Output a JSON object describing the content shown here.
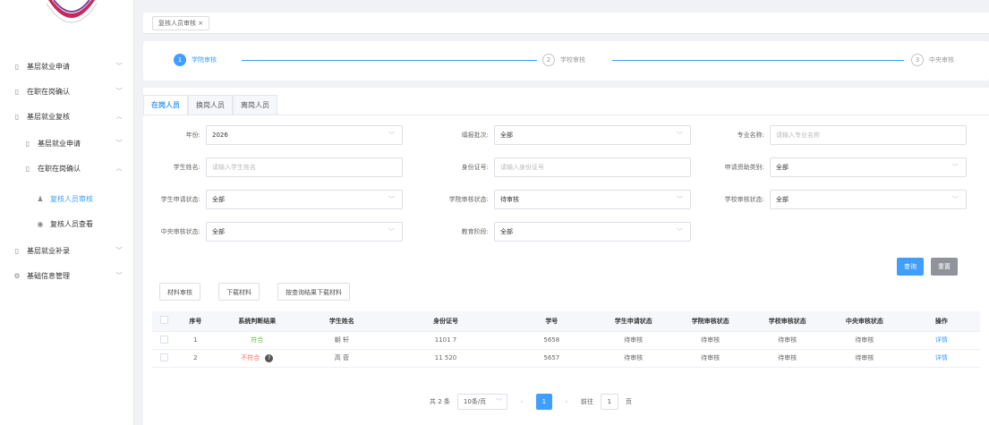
{
  "sidebar": {
    "items": [
      {
        "icon": "doc-icon",
        "label": "基层就业申请",
        "arrow": "﹀",
        "active": false
      },
      {
        "icon": "doc-icon",
        "label": "在职在岗确认",
        "arrow": "﹀",
        "active": false
      },
      {
        "icon": "doc-icon",
        "label": "基层就业复核",
        "arrow": "︿",
        "active": false
      },
      {
        "icon": "doc-icon",
        "label": "基层就业申请",
        "arrow": "﹀",
        "active": false
      },
      {
        "icon": "doc-icon",
        "label": "在职在岗确认",
        "arrow": "︿",
        "active": false
      },
      {
        "icon": "person-icon",
        "label": "复核人员审核",
        "arrow": "",
        "active": true
      },
      {
        "icon": "eye-icon",
        "label": "复核人员查看",
        "arrow": "",
        "active": false
      },
      {
        "icon": "doc-icon",
        "label": "基层就业补录",
        "arrow": "﹀",
        "active": false
      },
      {
        "icon": "gear-icon",
        "label": "基础信息管理",
        "arrow": "﹀",
        "active": false
      }
    ]
  },
  "tabbar": {
    "tab_label": "复核人员审核 ×"
  },
  "steps": [
    {
      "num": "1",
      "label": "学院审核"
    },
    {
      "num": "2",
      "label": "学校审核"
    },
    {
      "num": "3",
      "label": "中央审核"
    }
  ],
  "person_tabs": [
    "在岗人员",
    "换岗人员",
    "离岗人员"
  ],
  "filters": {
    "year": {
      "label": "年份:",
      "value": "2026"
    },
    "batch": {
      "label": "填报批次:",
      "value": "全部"
    },
    "major": {
      "label": "专业名称:",
      "placeholder": "请输入专业名称"
    },
    "student_name": {
      "label": "学生姓名:",
      "placeholder": "请输入学生姓名"
    },
    "id_number": {
      "label": "身份证号:",
      "placeholder": "请输入身份证号"
    },
    "aid_type": {
      "label": "申请资助类别:",
      "value": "全部"
    },
    "student_status": {
      "label": "学生申请状态:",
      "value": "全部"
    },
    "college_status": {
      "label": "学院审核状态:",
      "value": "待审核"
    },
    "school_status": {
      "label": "学校审核状态:",
      "value": "全部"
    },
    "central_status": {
      "label": "中央审核状态:",
      "value": "全部"
    },
    "edu_stage": {
      "label": "教育阶段:",
      "value": "全部"
    }
  },
  "actions": {
    "search": "查询",
    "reset": "重置"
  },
  "toolbar": {
    "review": "材料审核",
    "download": "下载材料",
    "download_by_query": "按查询结果下载材料"
  },
  "table": {
    "headers": [
      "序号",
      "系统判断结果",
      "学生姓名",
      "身份证号",
      "学号",
      "学生申请状态",
      "学院审核状态",
      "学校审核状态",
      "中央审核状态",
      "操作"
    ],
    "rows": [
      {
        "index": "1",
        "result": "符合",
        "result_ok": true,
        "name": "朝 轩",
        "id": "1101 7",
        "sid": "5658",
        "s1": "待审核",
        "s2": "待审核",
        "s3": "待审核",
        "s4": "待审核",
        "action": "详情"
      },
      {
        "index": "2",
        "result": "不符合",
        "result_ok": false,
        "name": "高 菅",
        "id": "11 520",
        "sid": "5657",
        "s1": "待审核",
        "s2": "待审核",
        "s3": "待审核",
        "s4": "待审核",
        "action": "详情"
      }
    ]
  },
  "pager": {
    "total": "共 2 条",
    "page_size": "10条/页",
    "current": "1",
    "goto": "前往",
    "goto_value": "1",
    "page_unit": "页"
  }
}
